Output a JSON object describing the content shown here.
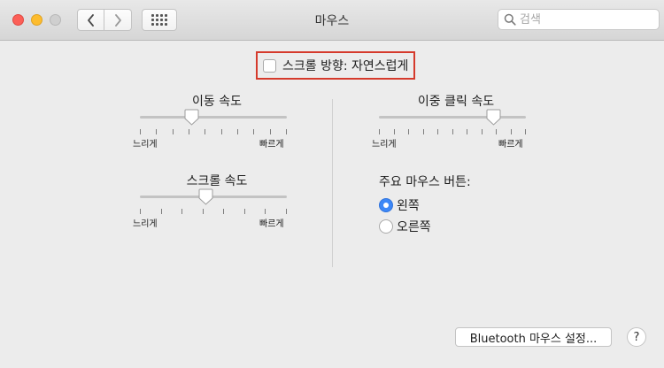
{
  "window": {
    "title": "마우스"
  },
  "search": {
    "placeholder": "검색",
    "value": ""
  },
  "scroll_direction": {
    "label": "스크롤 방향: 자연스럽게",
    "checked": false
  },
  "tracking_speed": {
    "title": "이동 속도",
    "min_label": "느리게",
    "max_label": "빠르게",
    "level": 0.35
  },
  "double_click_speed": {
    "title": "이중 클릭 속도",
    "min_label": "느리게",
    "max_label": "빠르게",
    "level": 0.78
  },
  "scroll_speed": {
    "title": "스크롤 속도",
    "min_label": "느리게",
    "max_label": "빠르게",
    "level": 0.45
  },
  "primary_button": {
    "title": "주요 마우스 버튼:",
    "options": [
      {
        "label": "왼쪽",
        "selected": true
      },
      {
        "label": "오른쪽",
        "selected": false
      }
    ]
  },
  "bluetooth_button": {
    "label": "Bluetooth 마우스 설정..."
  },
  "help_button": {
    "label": "?"
  },
  "colors": {
    "accent": "#3c87f7",
    "highlight_border": "#d53a2c"
  }
}
